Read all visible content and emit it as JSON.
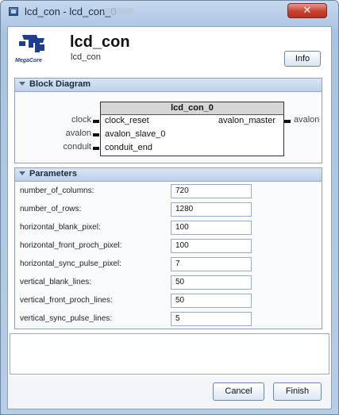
{
  "window": {
    "title": "lcd_con - lcd_con_0"
  },
  "header": {
    "logo_text": "MegaCore",
    "module_name": "lcd_con",
    "module_type": "lcd_con",
    "info_label": "Info"
  },
  "block_diagram": {
    "section_label": "Block Diagram",
    "component_name": "lcd_con_0",
    "interfaces": [
      {
        "external": "clock",
        "internal": "clock_reset"
      },
      {
        "external": "avalon",
        "internal": "avalon_slave_0"
      },
      {
        "external": "conduit",
        "internal": "conduit_end"
      }
    ],
    "output": {
      "internal": "avalon_master",
      "external": "avalon"
    }
  },
  "parameters": {
    "section_label": "Parameters",
    "rows": [
      {
        "label": "number_of_columns:",
        "value": "720"
      },
      {
        "label": "number_of_rows:",
        "value": "1280"
      },
      {
        "label": "horizontal_blank_pixel:",
        "value": "100"
      },
      {
        "label": "horizontal_front_proch_pixel:",
        "value": "100"
      },
      {
        "label": "horizontal_sync_pulse_pixel:",
        "value": "7"
      },
      {
        "label": "vertical_blank_lines:",
        "value": "50"
      },
      {
        "label": "vertical_front_proch_lines:",
        "value": "50"
      },
      {
        "label": "vertical_sync_pulse_lines:",
        "value": "5"
      }
    ]
  },
  "footer": {
    "cancel_label": "Cancel",
    "finish_label": "Finish"
  },
  "colors": {
    "close_button": "#c7412e",
    "title_bar": "#b8cde6",
    "section_header": "#c9d8ee"
  }
}
